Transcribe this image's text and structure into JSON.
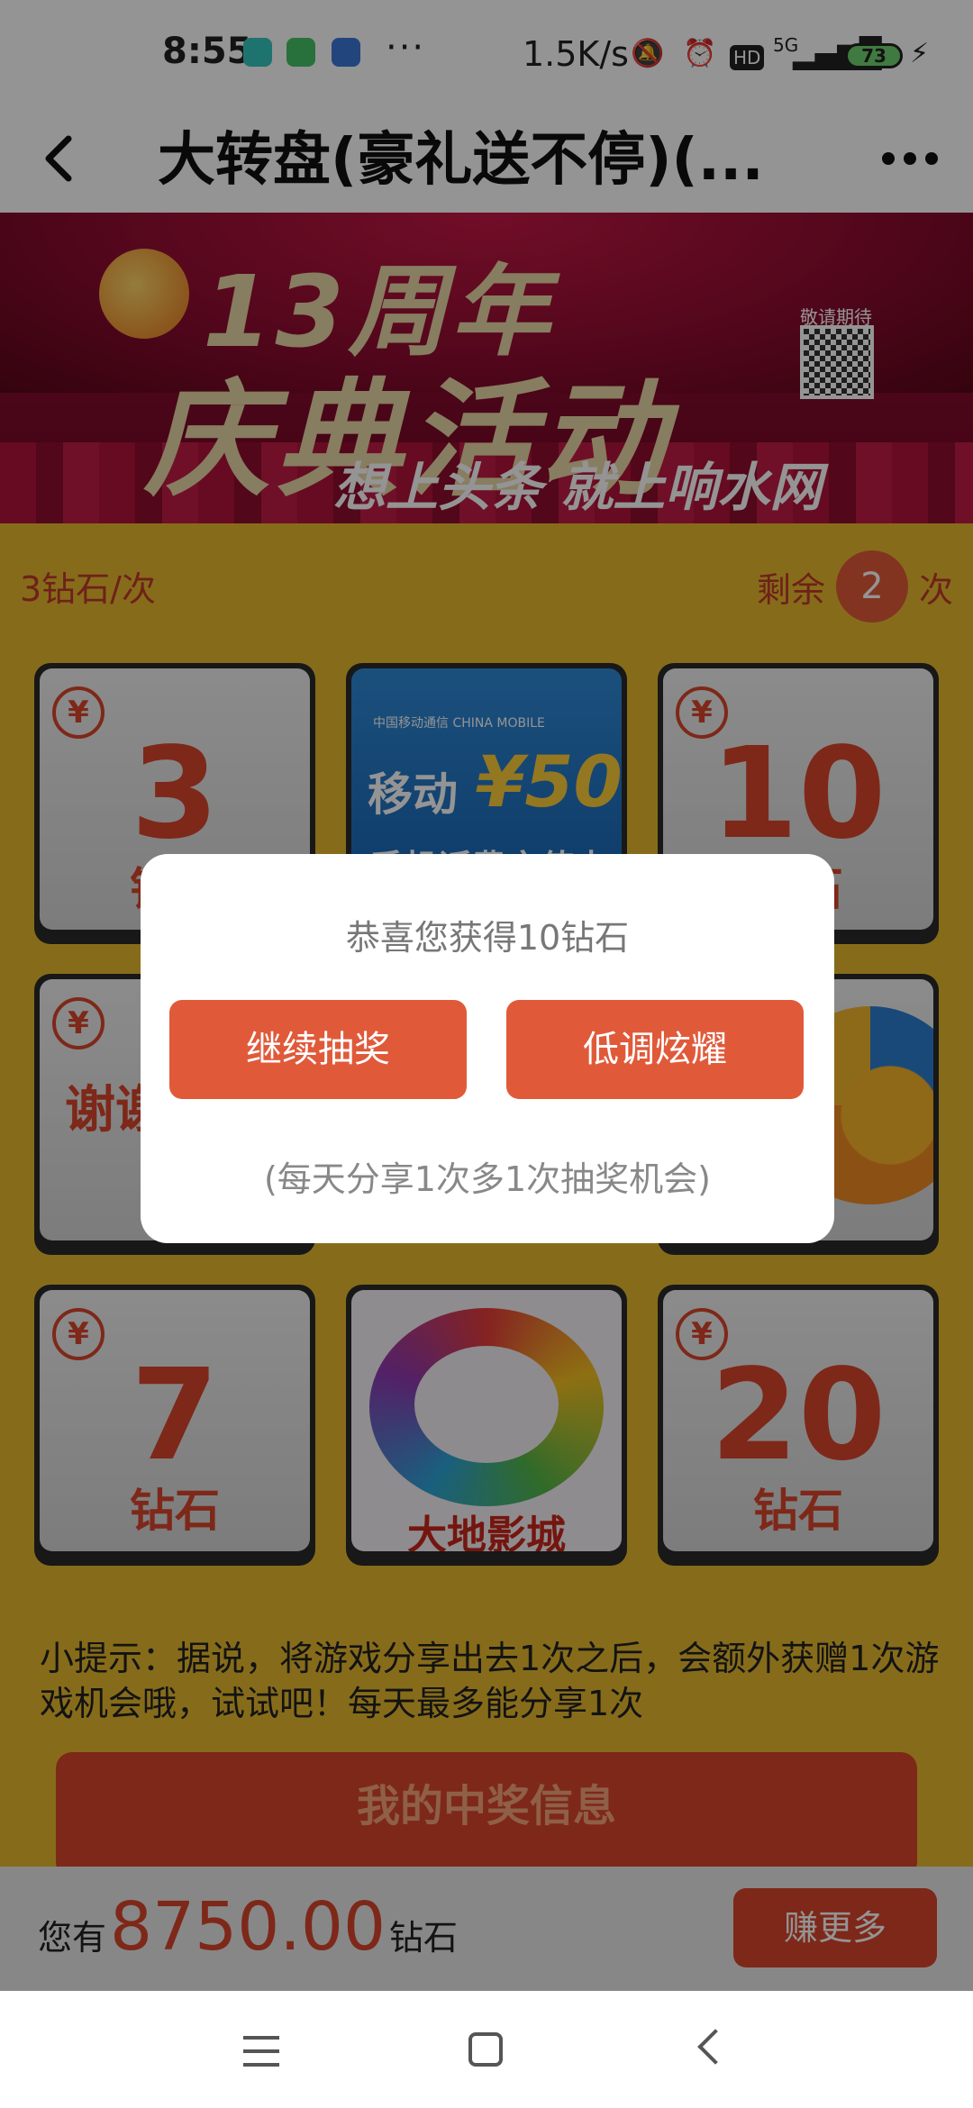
{
  "status_bar": {
    "time": "8:55",
    "more": "···",
    "speed": "1.5K/s",
    "network": "5G",
    "hd": "HD",
    "battery": "73"
  },
  "header": {
    "title": "大转盘(豪礼送不停)(..."
  },
  "banner": {
    "line1": "13周年",
    "line2": "庆典活动",
    "line3": "想上头条 就上响水网",
    "qr_label": "敬请期待"
  },
  "game": {
    "cost": "3钻石/次",
    "remaining_prefix": "剩余",
    "remaining_count": "2",
    "remaining_suffix": "次",
    "tiles": [
      {
        "value": "3",
        "unit": "钻石"
      },
      {
        "brand": "中国移动通信 CHINA MOBILE",
        "line1": "移动",
        "line2": "¥50",
        "line3": "手机话费充值卡"
      },
      {
        "value": "10",
        "unit": "钻石"
      },
      {
        "text": "谢谢"
      },
      {},
      {},
      {
        "value": "7",
        "unit": "钻石"
      },
      {
        "label": "大地影城"
      },
      {
        "value": "20",
        "unit": "钻石"
      }
    ],
    "tip": "小提示：据说，将游戏分享出去1次之后，会额外获赠1次游戏机会哦，试试吧！每天最多能分享1次",
    "record_button": "我的中奖信息"
  },
  "bottom_bar": {
    "prefix": "您有",
    "amount": "8750.00",
    "suffix": "钻石",
    "earn_button": "赚更多"
  },
  "dialog": {
    "message": "恭喜您获得10钻石",
    "continue_button": "继续抽奖",
    "share_button": "低调炫耀",
    "note": "(每天分享1次多1次抽奖机会)"
  },
  "colors": {
    "accent": "#e05a3a",
    "game_bg": "#e7bb2e",
    "prize_red": "#d9452b"
  }
}
